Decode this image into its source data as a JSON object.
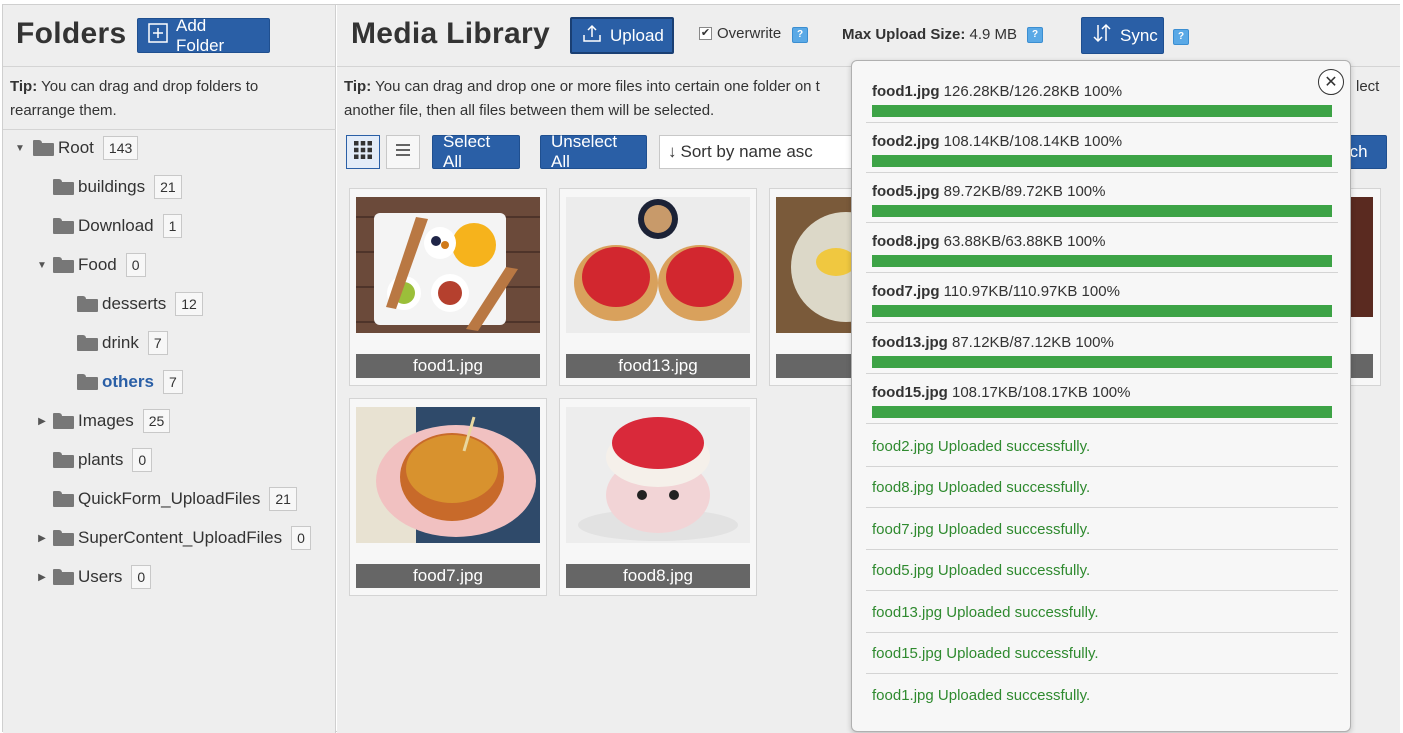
{
  "folders": {
    "title": "Folders",
    "add_folder_label": "Add Folder",
    "tip_bold": "Tip:",
    "tip_text_1": " You can drag and drop folders to",
    "tip_text_2": "rearrange them.",
    "tree": [
      {
        "label": "Root",
        "count": "143",
        "expanded": true
      },
      {
        "label": "buildings",
        "count": "21"
      },
      {
        "label": "Download",
        "count": "1"
      },
      {
        "label": "Food",
        "count": "0",
        "expanded": true
      },
      {
        "label": "desserts",
        "count": "12"
      },
      {
        "label": "drink",
        "count": "7"
      },
      {
        "label": "others",
        "count": "7",
        "active": true
      },
      {
        "label": "Images",
        "count": "25",
        "collapsed": true
      },
      {
        "label": "plants",
        "count": "0"
      },
      {
        "label": "QuickForm_UploadFiles",
        "count": "21"
      },
      {
        "label": "SuperContent_UploadFiles",
        "count": "0",
        "collapsed": true
      },
      {
        "label": "Users",
        "count": "0",
        "collapsed": true
      }
    ]
  },
  "library": {
    "title": "Media Library",
    "upload_label": "Upload",
    "overwrite_label": "Overwrite",
    "max_upload_bold": "Max Upload Size:",
    "max_upload_value": " 4.9 MB",
    "sync_label": "Sync",
    "tip_bold": "Tip:",
    "tip_text_1": " You can drag and drop one or more files into certain one folder on t",
    "tip_text_1_tail": "lect",
    "tip_text_2": "another file, then all files between them will be selected.",
    "select_all_label": "Select All",
    "unselect_all_label": "Unselect All",
    "sort_label": "Sort by name asc",
    "search_label_partial": "rch",
    "files": [
      {
        "name": "food1.jpg"
      },
      {
        "name": "food13.jpg"
      },
      {
        "name": "foo"
      },
      {
        "name": "food7.jpg"
      },
      {
        "name": "food8.jpg"
      }
    ]
  },
  "upload_popup": {
    "progress": [
      {
        "name": "food1.jpg",
        "detail": " 126.28KB/126.28KB 100%",
        "percent": 100
      },
      {
        "name": "food2.jpg",
        "detail": " 108.14KB/108.14KB 100%",
        "percent": 100
      },
      {
        "name": "food5.jpg",
        "detail": " 89.72KB/89.72KB 100%",
        "percent": 100
      },
      {
        "name": "food8.jpg",
        "detail": " 63.88KB/63.88KB 100%",
        "percent": 100
      },
      {
        "name": "food7.jpg",
        "detail": " 110.97KB/110.97KB 100%",
        "percent": 100
      },
      {
        "name": "food13.jpg",
        "detail": " 87.12KB/87.12KB 100%",
        "percent": 100
      },
      {
        "name": "food15.jpg",
        "detail": " 108.17KB/108.17KB 100%",
        "percent": 100
      }
    ],
    "messages": [
      "food2.jpg Uploaded successfully.",
      "food8.jpg Uploaded successfully.",
      "food7.jpg Uploaded successfully.",
      "food5.jpg Uploaded successfully.",
      "food13.jpg Uploaded successfully.",
      "food15.jpg Uploaded successfully.",
      "food1.jpg Uploaded successfully."
    ]
  },
  "colors": {
    "accent": "#2a5fa6",
    "progress": "#3da346",
    "success_text": "#2f8a2f"
  }
}
